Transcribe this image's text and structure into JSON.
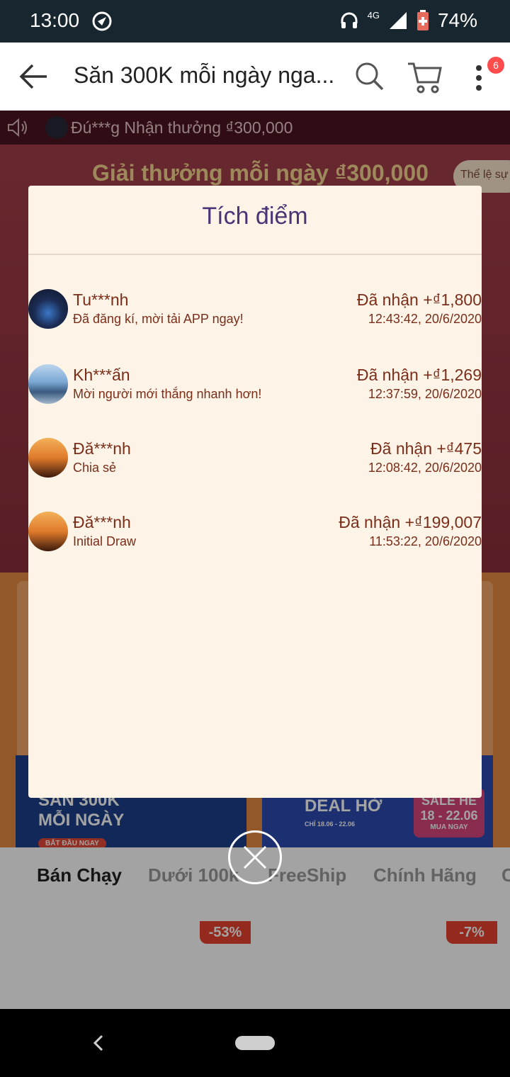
{
  "status": {
    "time": "13:00",
    "network": "4G",
    "battery": "74%"
  },
  "appbar": {
    "title": "Săn 300K mỗi ngày nga...",
    "cart_badge": "6"
  },
  "background": {
    "ticker_text": "Đú***g Nhận thưởng ₫300,000",
    "hero_title": "Giải thưởng mỗi ngày ₫300,000",
    "rules_pill": "Thể lệ sự",
    "banner_left": {
      "line1": "SĂN 300K",
      "line2": "MỖI NGÀY",
      "cta": "BẮT ĐẦU NGAY"
    },
    "banner_right": {
      "text": "DEAL HỜ",
      "sale": "SALE HÈ 18 - 22.06",
      "dates": "CHỈ 18.06 - 22.06",
      "cta": "MUA NGAY"
    },
    "tabs": [
      "Bán Chạy",
      "Dưới 100k",
      "FreeShip",
      "Chính Hãng",
      "C"
    ],
    "products": [
      {
        "discount": "-53%"
      },
      {
        "discount": "-7%"
      }
    ]
  },
  "modal": {
    "title": "Tích điểm",
    "entries": [
      {
        "name": "Tu***nh",
        "action": "Đã đăng kí, mời tải APP ngay!",
        "amount": "Đã nhận +₫1,800",
        "time": "12:43:42, 20/6/2020"
      },
      {
        "name": "Kh***ấn",
        "action": "Mời người mới thắng nhanh hơn!",
        "amount": "Đã nhận +₫1,269",
        "time": "12:37:59, 20/6/2020"
      },
      {
        "name": "Đă***nh",
        "action": "Chia sẻ",
        "amount": "Đã nhận +₫475",
        "time": "12:08:42, 20/6/2020"
      },
      {
        "name": "Đă***nh",
        "action": "Initial Draw",
        "amount": "Đã nhận +₫199,007",
        "time": "11:53:22, 20/6/2020"
      }
    ]
  }
}
